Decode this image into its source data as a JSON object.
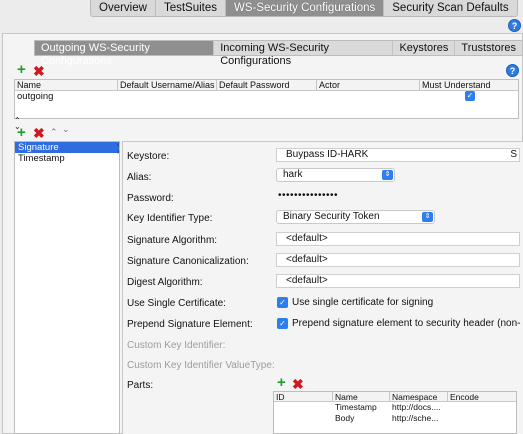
{
  "top_tabs": [
    "Overview",
    "TestSuites",
    "WS-Security Configurations",
    "Security Scan Defaults"
  ],
  "sub_tabs": [
    "Outgoing WS-Security Configurations",
    "Incoming WS-Security Configurations",
    "Keystores",
    "Truststores"
  ],
  "config_table": {
    "columns": [
      "Name",
      "Default Username/Alias",
      "Default Password",
      "Actor",
      "Must Understand"
    ],
    "rows": [
      {
        "name": "outgoing",
        "username": "",
        "password": "",
        "actor": "",
        "must_understand": true
      }
    ]
  },
  "entries": [
    {
      "label": "Signature",
      "selected": true
    },
    {
      "label": "Timestamp",
      "selected": false
    }
  ],
  "form": {
    "keystore_label": "Keystore:",
    "keystore_value": "Buypass ID-HARK",
    "keystore_suffix": "S",
    "alias_label": "Alias:",
    "alias_value": "hark",
    "password_label": "Password:",
    "password_value": "•••••••••••••••",
    "key_id_type_label": "Key Identifier Type:",
    "key_id_type_value": "Binary Security Token",
    "sig_alg_label": "Signature Algorithm:",
    "sig_alg_value": "<default>",
    "sig_canon_label": "Signature Canonicalization:",
    "sig_canon_value": "<default>",
    "digest_alg_label": "Digest Algorithm:",
    "digest_alg_value": "<default>",
    "single_cert_label": "Use Single Certificate:",
    "single_cert_text": "Use single certificate for signing",
    "single_cert_checked": true,
    "prepend_label": "Prepend Signature Element:",
    "prepend_text": "Prepend signature element to security header (non-st",
    "prepend_checked": true,
    "custom_key_id_label": "Custom Key Identifier:",
    "custom_key_vt_label": "Custom Key Identifier ValueType:",
    "parts_label": "Parts:"
  },
  "parts_table": {
    "columns": [
      "ID",
      "Name",
      "Namespace",
      "Encode"
    ],
    "rows": [
      {
        "id": "",
        "name": "Timestamp",
        "namespace": "http://docs....",
        "encode": ""
      },
      {
        "id": "",
        "name": "Body",
        "namespace": "http://sche...",
        "encode": ""
      }
    ]
  },
  "icons": {
    "help": "help-icon",
    "add": "plus-icon",
    "remove": "x-icon",
    "move_up": "chevron-up-icon",
    "move_down": "chevron-down-icon",
    "select_arrows": "updown-arrows-icon"
  },
  "colors": {
    "accent": "#2d7ff0",
    "add": "#1d9e2a",
    "remove": "#d2171e",
    "selection": "#2e6ce0"
  }
}
